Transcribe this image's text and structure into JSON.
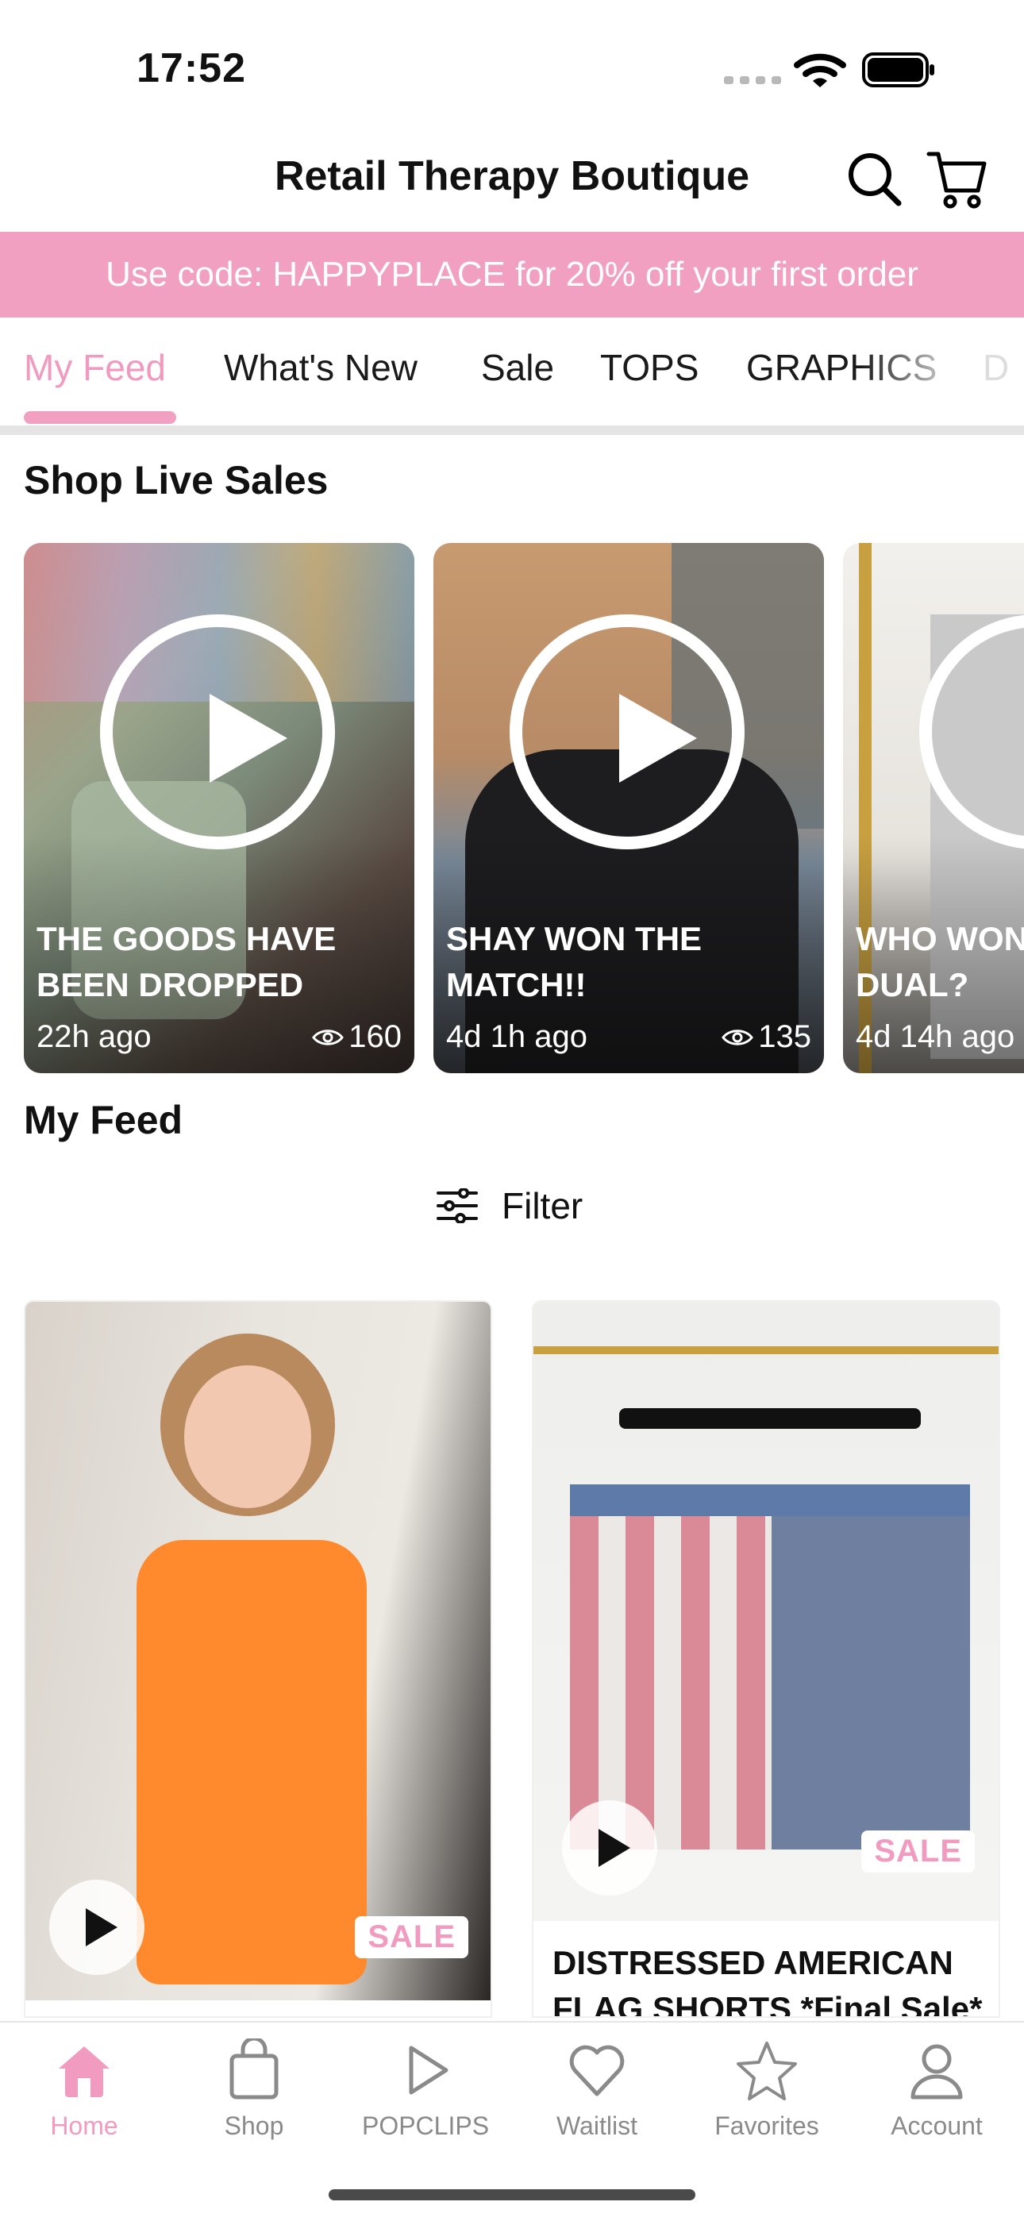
{
  "status_bar": {
    "time": "17:52"
  },
  "header": {
    "title": "Retail Therapy Boutique"
  },
  "promo": {
    "text": "Use code: HAPPYPLACE for 20% off your first order"
  },
  "tabs": [
    {
      "label": "My Feed",
      "active": true
    },
    {
      "label": "What's New",
      "active": false
    },
    {
      "label": "Sale",
      "active": false
    },
    {
      "label": "TOPS",
      "active": false
    },
    {
      "label": "GRAPHICS",
      "active": false
    },
    {
      "label": "D",
      "active": false
    }
  ],
  "live_section": {
    "title": "Shop Live Sales",
    "cards": [
      {
        "title": "THE GOODS HAVE BEEN DROPPED",
        "time": "22h ago",
        "views": "160"
      },
      {
        "title": "SHAY WON THE MATCH!!",
        "time": "4d 1h ago",
        "views": "135"
      },
      {
        "title": "WHO WON THE DUAL?",
        "time": "4d 14h ago",
        "views": ""
      }
    ]
  },
  "feed": {
    "title": "My Feed",
    "filter_label": "Filter",
    "products": [
      {
        "title": "",
        "badge": "SALE"
      },
      {
        "title": "DISTRESSED AMERICAN FLAG SHORTS *Final Sale*",
        "badge": "SALE"
      }
    ]
  },
  "bottom_nav": {
    "items": [
      {
        "label": "Home",
        "icon": "home-icon",
        "active": true
      },
      {
        "label": "Shop",
        "icon": "shopping-bag-icon",
        "active": false
      },
      {
        "label": "POPCLIPS",
        "icon": "play-icon",
        "active": false
      },
      {
        "label": "Waitlist",
        "icon": "heart-icon",
        "active": false
      },
      {
        "label": "Favorites",
        "icon": "star-icon",
        "active": false
      },
      {
        "label": "Account",
        "icon": "person-icon",
        "active": false
      }
    ]
  },
  "colors": {
    "accent_pink": "#f1a0c2",
    "active_tab": "#f09ac0",
    "nav_inactive": "#8a8a8a"
  }
}
